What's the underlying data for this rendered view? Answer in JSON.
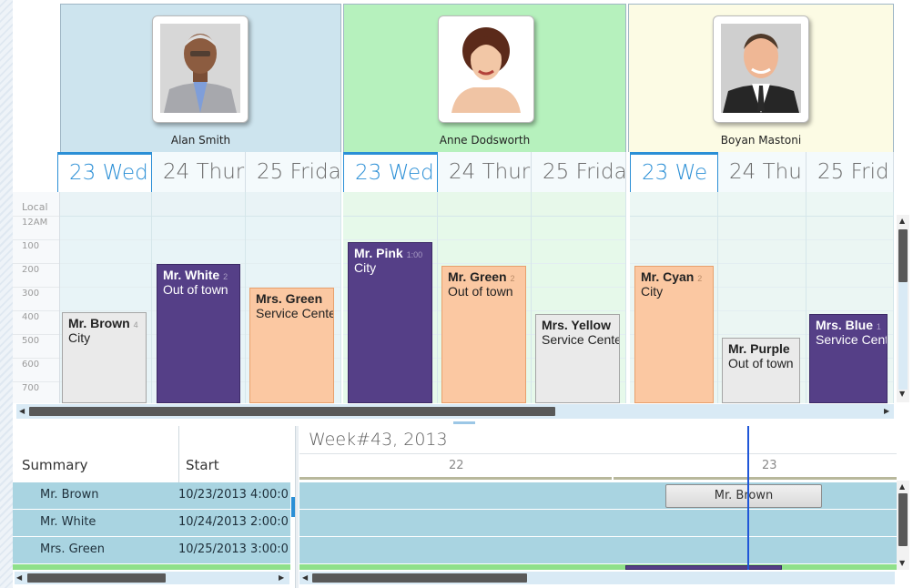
{
  "resources": [
    {
      "name": "Alan Smith",
      "color": "#cde4ee",
      "days": [
        {
          "label": "23 Wed",
          "today": true
        },
        {
          "label": "24 Thur"
        },
        {
          "label": "25 Frida"
        }
      ]
    },
    {
      "name": "Anne Dodsworth",
      "color": "#b6f1bd",
      "days": [
        {
          "label": "23 Wed",
          "today": true
        },
        {
          "label": "24 Thur"
        },
        {
          "label": "25 Frida"
        }
      ]
    },
    {
      "name": "Boyan Mastoni",
      "color": "#fcfbe4",
      "days": [
        {
          "label": "23 We",
          "today": true
        },
        {
          "label": "24 Thu"
        },
        {
          "label": "25 Frid"
        }
      ]
    }
  ],
  "ruler": {
    "zone_label": "Local",
    "hours": [
      "12AM",
      "100",
      "200",
      "300",
      "400",
      "500",
      "600",
      "700"
    ]
  },
  "appointments": [
    {
      "title": "Mr. Brown",
      "location": "City",
      "style": "gray",
      "peek": "4"
    },
    {
      "title": "Mr. White",
      "location": "Out of town",
      "style": "purple",
      "peek": "2"
    },
    {
      "title": "Mrs. Green",
      "location": "Service Cente",
      "style": "orange",
      "peek": ""
    },
    {
      "title": "Mr. Pink",
      "location": "City",
      "style": "purple",
      "peek": "1:00"
    },
    {
      "title": "Mr. Green",
      "location": "Out of town",
      "style": "orange",
      "peek": "2"
    },
    {
      "title": "Mrs. Yellow",
      "location": "Service Cente",
      "style": "gray",
      "peek": ""
    },
    {
      "title": "Mr. Cyan",
      "location": "City",
      "style": "orange",
      "peek": "2"
    },
    {
      "title": "Mr. Purple",
      "location": "Out of town",
      "style": "gray",
      "peek": ""
    },
    {
      "title": "Mrs. Blue",
      "location": "Service Cent",
      "style": "purple",
      "peek": "1"
    }
  ],
  "grid": {
    "columns": [
      "Summary",
      "Start"
    ],
    "rows": [
      {
        "summary": "Mr. Brown",
        "start": "10/23/2013 4:00:0"
      },
      {
        "summary": "Mr. White",
        "start": "10/24/2013 2:00:0"
      },
      {
        "summary": "Mrs. Green",
        "start": "10/25/2013 3:00:0"
      }
    ]
  },
  "timeline": {
    "week_label": "Week#43, 2013",
    "day_ticks": [
      "22",
      "23"
    ],
    "bar_label": "Mr. Brown"
  },
  "colors": {
    "accent": "#2b8fd6",
    "purple": "#553f87",
    "orange": "#fbc8a2",
    "gray": "#eaeaea",
    "row_blue": "#a9d4e1",
    "row_green": "#8fe08a",
    "current_time_line": "#1f56d8"
  }
}
